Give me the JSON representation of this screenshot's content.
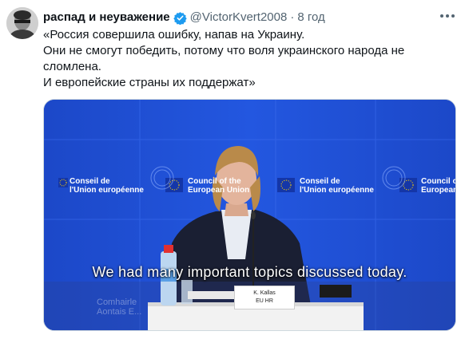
{
  "tweet": {
    "author_name": "распад и неуважение",
    "handle": "@VictorKvert2008",
    "separator": "·",
    "time": "8 год",
    "text_lines": [
      "«Россия совершила ошибку, напав на Украину.",
      "Они не смогут победить, потому что воля украинского народа не сломлена.",
      "И европейские страны их поддержат»"
    ]
  },
  "video": {
    "subtitle": "We had many important topics discussed today.",
    "nameplate_name": "K. Kallas",
    "nameplate_title": "EU HR",
    "logo_council_fr": "Conseil de\nl'Union européenne",
    "logo_council_en": "Council of the\nEuropean Union",
    "logo_council_fr_2": "Conseil de\nl'Union européenne",
    "logo_council_en_2": "Council of the\nEuropean Union",
    "watermark_lines": "Comhairle\nAontais E..."
  },
  "colors": {
    "accent_verified": "#1d9bf0",
    "backdrop_blue": "#1f4fd6",
    "text_secondary": "#536471"
  },
  "icons": [
    "verified-badge-icon",
    "more-options-icon",
    "eu-flag-icon"
  ]
}
